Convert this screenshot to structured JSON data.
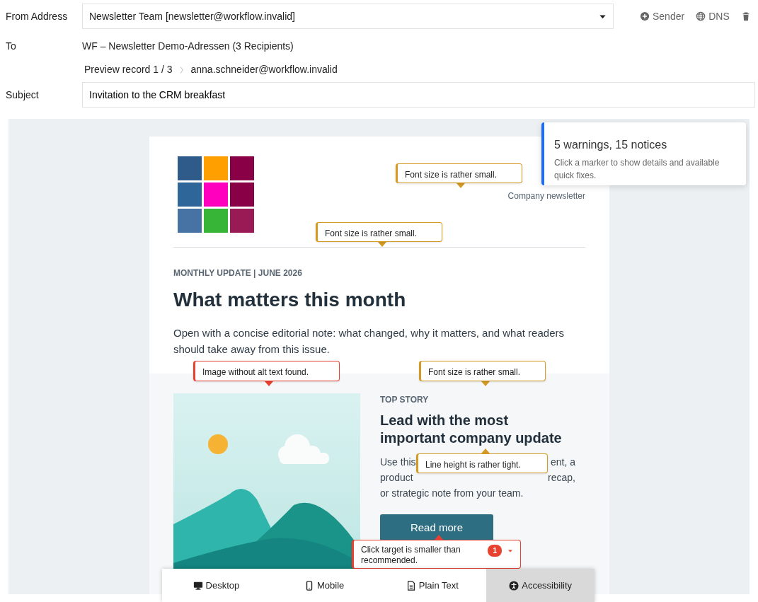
{
  "from": {
    "label": "From Address",
    "value": "Newsletter Team [newsletter@workflow.invalid]"
  },
  "actions": [
    {
      "kind": "sender",
      "label": "Sender"
    },
    {
      "kind": "dns",
      "label": "DNS"
    },
    {
      "kind": "delete"
    }
  ],
  "to": {
    "label": "To",
    "value": "WF – Newsletter Demo-Adressen (3 Recipients)"
  },
  "preview": {
    "record": "Preview record 1 / 3",
    "email": "anna.schneider@workflow.invalid"
  },
  "subject": {
    "label": "Subject",
    "value": "Invitation to the CRM breakfast"
  },
  "summary": {
    "title": "5 warnings, 15 notices",
    "text": "Click a marker to show details and available quick fixes."
  },
  "newsletter": {
    "tagline": "Company newsletter",
    "eyebrow": "MONTHLY UPDATE | JUNE 2026",
    "heading": "What matters this month",
    "intro": "Open with a concise editorial note: what changed, why it matters, and what readers should take away from this issue.",
    "story": {
      "eyebrow": "TOP STORY",
      "heading": "Lead with the most important company update",
      "body_lines": [
        {
          "left": "Use this",
          "right": "ent, a"
        },
        {
          "left": "product",
          "right": "recap,"
        },
        {
          "left": "or strategic note from your team."
        }
      ],
      "button": "Read more"
    }
  },
  "markers": [
    {
      "kind": "warning",
      "text": "Font size is rather small."
    },
    {
      "kind": "warning",
      "text": "Font size is rather small."
    },
    {
      "kind": "error",
      "text": "Image without alt text found."
    },
    {
      "kind": "warning",
      "text": "Font size is rather small."
    },
    {
      "kind": "warning",
      "text": "Line height is rather tight."
    },
    {
      "kind": "error",
      "text": "Click target is smaller than recommended.",
      "count": "1"
    }
  ],
  "tabs": [
    {
      "kind": "desktop",
      "label": "Desktop",
      "selected": false
    },
    {
      "kind": "mobile",
      "label": "Mobile",
      "selected": false
    },
    {
      "kind": "text",
      "label": "Plain Text",
      "selected": false
    },
    {
      "kind": "accessibility",
      "label": "Accessibility",
      "selected": true
    }
  ]
}
